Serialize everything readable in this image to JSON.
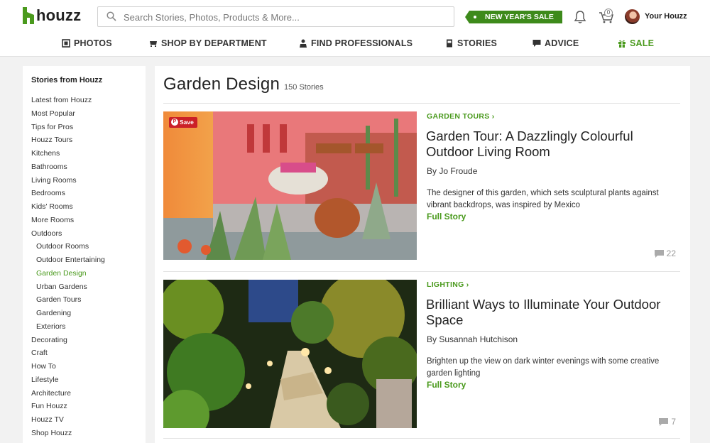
{
  "header": {
    "logo_text": "houzz",
    "search_placeholder": "Search Stories, Photos, Products & More...",
    "sale_badge": "NEW YEAR'S SALE",
    "cart_count": "0",
    "user_label": "Your Houzz",
    "accent_color": "#4a9a1d"
  },
  "nav": {
    "photos": "PHOTOS",
    "shop": "SHOP BY DEPARTMENT",
    "find_pros": "FIND PROFESSIONALS",
    "stories": "STORIES",
    "advice": "ADVICE",
    "sale": "SALE"
  },
  "sidebar": {
    "heading": "Stories from Houzz",
    "items": [
      {
        "label": "Latest from Houzz"
      },
      {
        "label": "Most Popular"
      },
      {
        "label": "Tips for Pros"
      },
      {
        "label": "Houzz Tours"
      },
      {
        "label": "Kitchens"
      },
      {
        "label": "Bathrooms"
      },
      {
        "label": "Living Rooms"
      },
      {
        "label": "Bedrooms"
      },
      {
        "label": "Kids' Rooms"
      },
      {
        "label": "More Rooms"
      },
      {
        "label": "Outdoors"
      },
      {
        "label": "Outdoor Rooms"
      },
      {
        "label": "Outdoor Entertaining"
      },
      {
        "label": "Garden Design"
      },
      {
        "label": "Urban Gardens"
      },
      {
        "label": "Garden Tours"
      },
      {
        "label": "Gardening"
      },
      {
        "label": "Exteriors"
      },
      {
        "label": "Decorating"
      },
      {
        "label": "Craft"
      },
      {
        "label": "How To"
      },
      {
        "label": "Lifestyle"
      },
      {
        "label": "Architecture"
      },
      {
        "label": "Fun Houzz"
      },
      {
        "label": "Houzz TV"
      },
      {
        "label": "Shop Houzz"
      }
    ]
  },
  "main": {
    "title": "Garden Design",
    "story_count": "150 Stories",
    "stories": [
      {
        "category": "GARDEN TOURS ›",
        "title": "Garden Tour: A Dazzlingly Colourful Outdoor Living Room",
        "byline": "By Jo Froude",
        "description": "The designer of this garden, which sets sculptural plants against vibrant backdrops, was inspired by Mexico",
        "cta": "Full Story",
        "comments": "22",
        "save_label": "Save"
      },
      {
        "category": "LIGHTING ›",
        "title": "Brilliant Ways to Illuminate Your Outdoor Space",
        "byline": "By Susannah Hutchison",
        "description": "Brighten up the view on dark winter evenings with some creative garden lighting",
        "cta": "Full Story",
        "comments": "7"
      }
    ]
  }
}
